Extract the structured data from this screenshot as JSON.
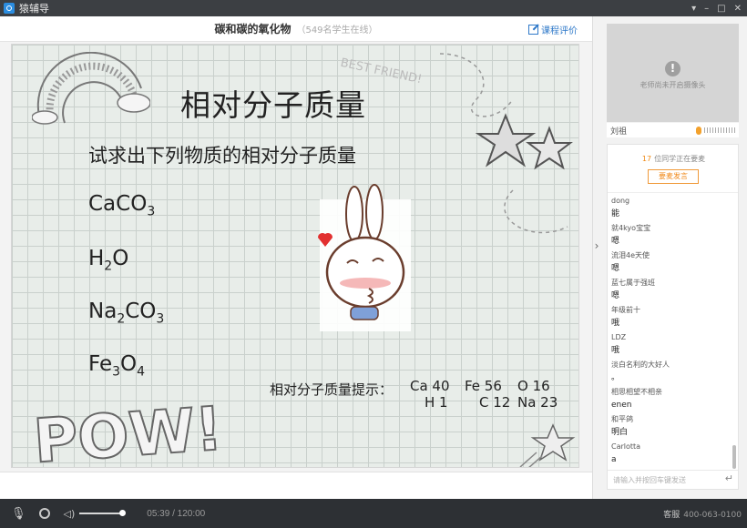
{
  "window": {
    "app_title": "猿辅导",
    "controls": [
      "▾",
      "–",
      "□",
      "✕"
    ]
  },
  "lesson": {
    "title": "碳和碳的氧化物",
    "online": "（549名学生在线）",
    "rate_label": "课程评价"
  },
  "slide": {
    "heading": "相对分子质量",
    "prompt": "试求出下列物质的相对分子质量",
    "formulas": [
      {
        "parts": [
          "CaCO",
          "3",
          ""
        ]
      },
      {
        "parts": [
          "H",
          "2",
          "O"
        ]
      },
      {
        "parts": [
          "Na",
          "2",
          "CO"
        ],
        "tail_sub": "3"
      },
      {
        "parts": [
          "Fe",
          "3",
          "O"
        ],
        "tail_sub": "4"
      }
    ],
    "hint_label": "相对分子质量提示：",
    "hint_row1": [
      "Ca 40",
      "Fe 56",
      "O 16"
    ],
    "hint_row2": [
      "H 1",
      "C 12",
      "Na 23"
    ],
    "doodle_text": "POW!",
    "friend_text": "BEST FRIEND!"
  },
  "camera": {
    "message": "老师尚未开启摄像头",
    "teacher_name": "刘祖"
  },
  "chat": {
    "hand_count": "17",
    "hand_text": "位同学正在要麦",
    "raise_label": "要麦发言",
    "messages": [
      {
        "user": "dong",
        "text": "能"
      },
      {
        "user": "就4kyo宝宝",
        "text": "嗯"
      },
      {
        "user": "流泪4e天使",
        "text": "嗯"
      },
      {
        "user": "蓝七属于强班",
        "text": "嗯"
      },
      {
        "user": "年级前十",
        "text": "哦"
      },
      {
        "user": "LDZ",
        "text": "哦"
      },
      {
        "user": "淡白名利的大好人",
        "text": "。"
      },
      {
        "user": "相思相望不相亲",
        "text": "enen"
      },
      {
        "user": "和平鸽",
        "text": "明白"
      },
      {
        "user": "Carlotta",
        "text": "a"
      }
    ],
    "input_placeholder": "请输入并按回车键发送"
  },
  "controls": {
    "time": "05:39 / 120:00",
    "support_label": "客服",
    "support_phone": "400-063-0100"
  },
  "colors": {
    "accent": "#f0891a",
    "link": "#2f79c9",
    "bar": "#2d3034"
  }
}
